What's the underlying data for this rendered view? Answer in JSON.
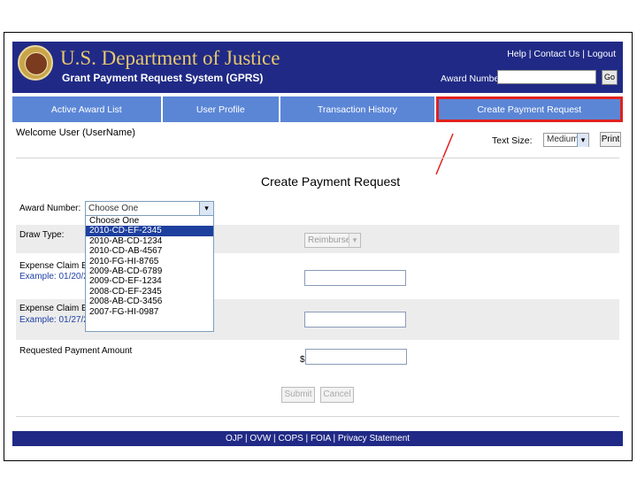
{
  "header": {
    "agency_title": "U.S. Department of Justice",
    "system_title": "Grant Payment Request System (GPRS)",
    "links": [
      "Help",
      "Contact Us",
      "Logout"
    ],
    "award_number_label": "Award Number:",
    "award_number_value": "",
    "go_label": "Go"
  },
  "nav": {
    "tabs": [
      {
        "label": "Active Award List"
      },
      {
        "label": "User Profile"
      },
      {
        "label": "Transaction History"
      },
      {
        "label": "Create Payment Request"
      }
    ],
    "active_index": 3,
    "highlight_color": "#e0221f"
  },
  "toolbar": {
    "welcome": "Welcome User (UserName)",
    "text_size_label": "Text Size:",
    "text_size_value": "Medium",
    "print_label": "Print"
  },
  "form": {
    "title": "Create Payment Request",
    "award_number_label": "Award Number:",
    "award_select_value": "Choose One",
    "award_options": [
      "Choose One",
      "2010-CD-EF-2345",
      "2010-AB-CD-1234",
      "2010-CD-AB-4567",
      "2010-FG-HI-8765",
      "2009-AB-CD-6789",
      "2009-CD-EF-1234",
      "2008-CD-EF-2345",
      "2008-AB-CD-3456",
      "2007-FG-HI-0987"
    ],
    "highlighted_option": 1,
    "draw_type_label": "Draw Type:",
    "draw_type_value": "Reimburse",
    "expense_begin_label": "Expense Claim Beginning Date",
    "expense_begin_example": "Example: 01/20/2010",
    "expense_end_label": "Expense Claim End Date",
    "expense_end_example": "Example: 01/27/2010",
    "requested_amount_label": "Requested Payment Amount",
    "currency_symbol": "$",
    "submit_label": "Submit",
    "cancel_label": "Cancel"
  },
  "footer": {
    "links": [
      "OJP",
      "OVW",
      "COPS",
      "FOIA",
      "Privacy Statement"
    ]
  },
  "colors": {
    "header_bg": "#202a86",
    "nav_bg": "#5b86d6",
    "title_gold": "#e8c86c"
  }
}
